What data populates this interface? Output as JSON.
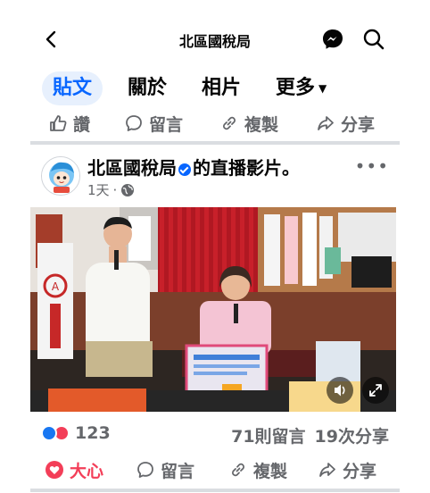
{
  "topbar": {
    "title": "北區國稅局"
  },
  "tabs": {
    "posts": "貼文",
    "about": "關於",
    "photos": "相片",
    "more": "更多"
  },
  "top_actions": {
    "like": "讚",
    "comment": "留言",
    "copy": "複製",
    "share": "分享"
  },
  "post": {
    "page_name": "北區國稅局",
    "title_suffix": "的直播影片。",
    "time": "1天",
    "separator": "·",
    "reaction_count": "123",
    "comments": "71則留言",
    "shares": "19次分享"
  },
  "bottom_actions": {
    "love": "大心",
    "comment": "留言",
    "copy": "複製",
    "share": "分享"
  },
  "colors": {
    "accent": "#0866ff",
    "love": "#f33e58",
    "muted": "#65676b",
    "tab_bg": "#e7f0fd"
  },
  "icons": [
    "back-icon",
    "messenger-icon",
    "search-icon",
    "caret-down-icon",
    "thumbs-up-icon",
    "comment-icon",
    "link-icon",
    "share-icon",
    "verified-icon",
    "globe-icon",
    "more-icon",
    "volume-icon",
    "fullscreen-icon",
    "love-icon"
  ]
}
